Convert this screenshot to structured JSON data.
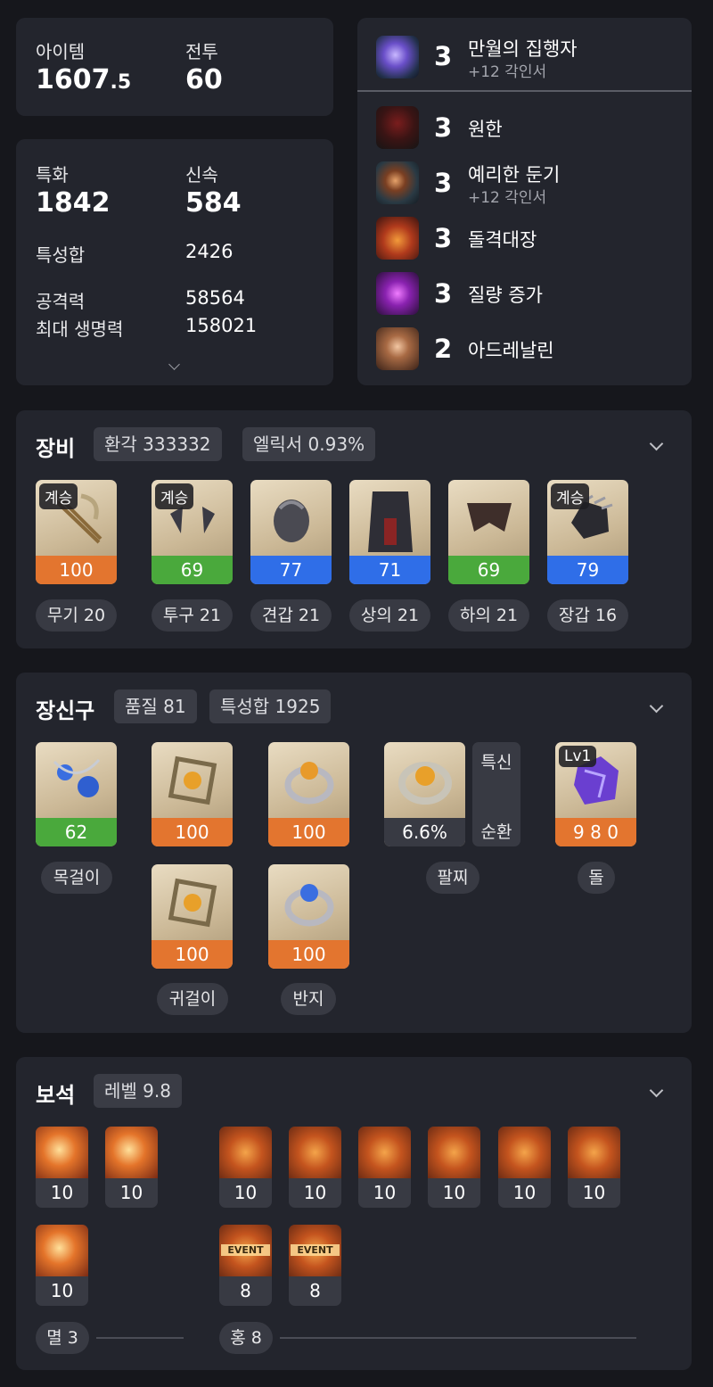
{
  "stats_top": {
    "item_label": "아이템",
    "item_value_main": "1607",
    "item_value_dec": ".5",
    "combat_label": "전투",
    "combat_value": "60"
  },
  "stats_main": {
    "spec_label": "특화",
    "spec_value": "1842",
    "swift_label": "신속",
    "swift_value": "584",
    "stat_sum_label": "특성합",
    "stat_sum_value": "2426",
    "attack_label": "공격력",
    "attack_value": "58564",
    "hp_label": "최대 생명력",
    "hp_value": "158021"
  },
  "engravings": [
    {
      "level": "3",
      "name": "만월의 집행자",
      "sub": "+12 각인서",
      "icon": "full-moon-executioner-icon"
    },
    {
      "level": "3",
      "name": "원한",
      "sub": "",
      "icon": "grudge-icon"
    },
    {
      "level": "3",
      "name": "예리한 둔기",
      "sub": "+12 각인서",
      "icon": "keen-blunt-weapon-icon"
    },
    {
      "level": "3",
      "name": "돌격대장",
      "sub": "",
      "icon": "raid-captain-icon"
    },
    {
      "level": "3",
      "name": "질량 증가",
      "sub": "",
      "icon": "mass-increase-icon"
    },
    {
      "level": "2",
      "name": "아드레날린",
      "sub": "",
      "icon": "adrenaline-icon"
    }
  ],
  "equipment": {
    "title": "장비",
    "chip1": "환각 333332",
    "chip2": "엘릭서 0.93%",
    "items": [
      {
        "badge": "계승",
        "quality": "100",
        "label": "무기 20",
        "color": "orange",
        "icon": "weapon-icon"
      },
      {
        "badge": "계승",
        "quality": "69",
        "label": "투구 21",
        "color": "green",
        "icon": "helmet-icon"
      },
      {
        "badge": "",
        "quality": "77",
        "label": "견갑 21",
        "color": "blue",
        "icon": "shoulder-icon"
      },
      {
        "badge": "",
        "quality": "71",
        "label": "상의 21",
        "color": "blue",
        "icon": "chest-icon"
      },
      {
        "badge": "",
        "quality": "69",
        "label": "하의 21",
        "color": "green",
        "icon": "pants-icon"
      },
      {
        "badge": "계승",
        "quality": "79",
        "label": "장갑 16",
        "color": "blue",
        "icon": "gloves-icon"
      }
    ]
  },
  "accessories": {
    "title": "장신구",
    "chip1": "품질 81",
    "chip2": "특성합 1925",
    "necklace": {
      "quality": "62",
      "label": "목걸이"
    },
    "earring1": {
      "quality": "100"
    },
    "earring2": {
      "quality": "100"
    },
    "earring_label": "귀걸이",
    "ring1": {
      "quality": "100"
    },
    "ring2": {
      "quality": "100"
    },
    "ring_label": "반지",
    "bracelet": {
      "value": "6.6%",
      "label": "팔찌",
      "side_top": "특신",
      "side_bottom": "순환"
    },
    "stone": {
      "badge": "Lv1",
      "value": "9 8 0",
      "label": "돌"
    }
  },
  "gems": {
    "title": "보석",
    "chip": "레벨 9.8",
    "doom": [
      {
        "value": "10"
      },
      {
        "value": "10"
      },
      {
        "value": "10"
      }
    ],
    "crimson": [
      {
        "value": "10"
      },
      {
        "value": "10"
      },
      {
        "value": "10"
      },
      {
        "value": "10"
      },
      {
        "value": "10"
      },
      {
        "value": "10"
      },
      {
        "value": "8",
        "badge": "EVENT"
      },
      {
        "value": "8",
        "badge": "EVENT"
      }
    ],
    "doom_label": "멸 3",
    "crimson_label": "홍 8"
  }
}
